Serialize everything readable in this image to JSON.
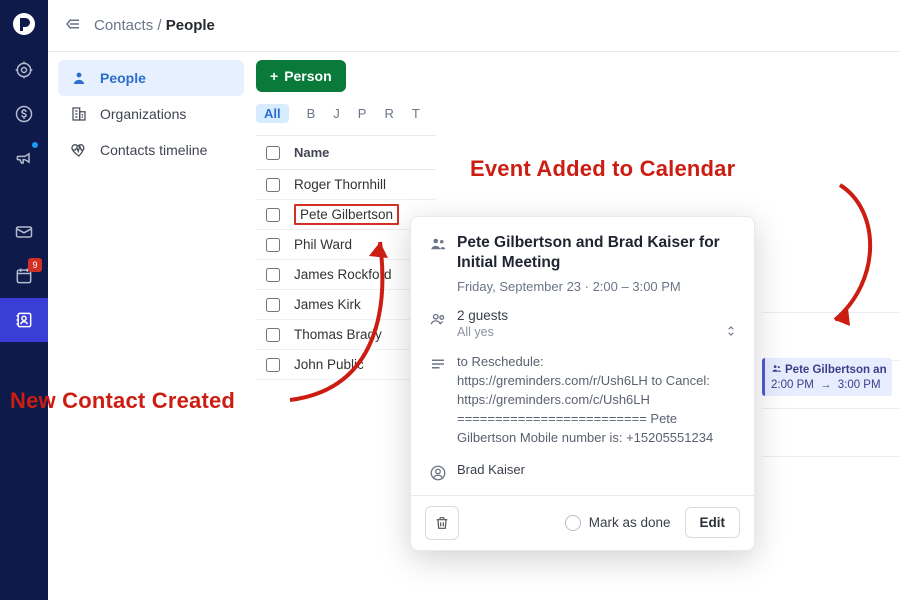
{
  "breadcrumb": {
    "parent": "Contacts",
    "sep": "/",
    "current": "People"
  },
  "rail": {
    "calendar_badge": "9"
  },
  "sidenav": {
    "items": [
      {
        "label": "People"
      },
      {
        "label": "Organizations"
      },
      {
        "label": "Contacts timeline"
      }
    ]
  },
  "toolbar": {
    "add_person_label": "Person"
  },
  "letter_filter": {
    "all": "All",
    "letters": [
      "B",
      "J",
      "P",
      "R",
      "T"
    ]
  },
  "table": {
    "name_header": "Name",
    "rows": [
      {
        "name": "Roger Thornhill"
      },
      {
        "name": "Pete Gilbertson"
      },
      {
        "name": "Phil Ward"
      },
      {
        "name": "James Rockford"
      },
      {
        "name": "James Kirk"
      },
      {
        "name": "Thomas Brady"
      },
      {
        "name": "John Public"
      }
    ]
  },
  "popover": {
    "title": "Pete Gilbertson and Brad Kaiser for Initial Meeting",
    "time_text": "Friday, September 23 · 2:00 – 3:00 PM",
    "guests_count": "2 guests",
    "guests_status": "All yes",
    "description": "to Reschedule: https://greminders.com/r/Ush6LH to Cancel: https://greminders.com/c/Ush6LH ========================= Pete Gilbertson Mobile number is: +15205551234",
    "owner": "Brad Kaiser",
    "mark_done_label": "Mark as done",
    "edit_label": "Edit"
  },
  "calendar_event": {
    "title": "Pete Gilbertson an",
    "time_from": "2:00 PM",
    "time_to": "3:00 PM"
  },
  "annotations": {
    "event_added": "Event Added to Calendar",
    "new_contact": "New Contact Created"
  }
}
